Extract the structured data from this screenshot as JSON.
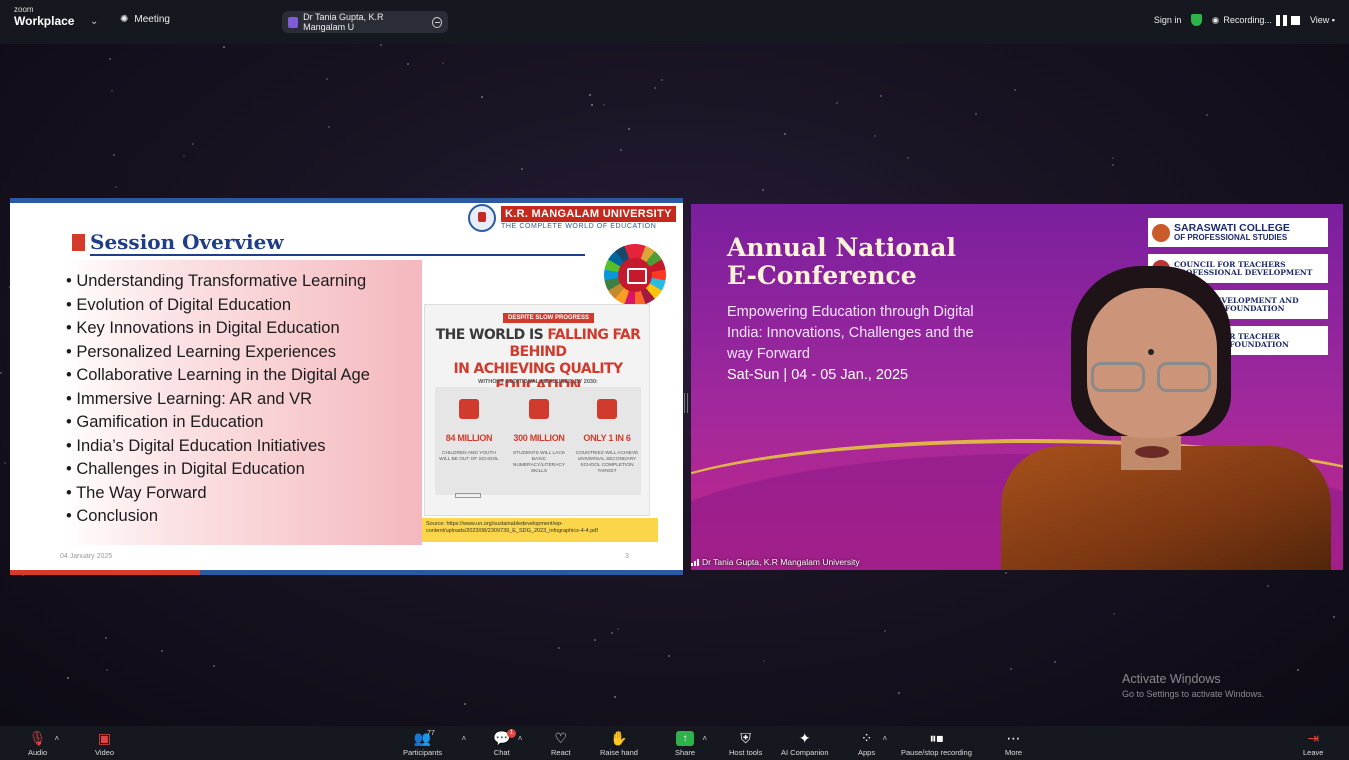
{
  "topbar": {
    "brand_small": "zoom",
    "brand": "Workplace",
    "meeting_label": "Meeting",
    "participant_pill": "Dr Tania Gupta, K.R Mangalam U",
    "sign_in": "Sign in",
    "recording": "Recording...",
    "view": "View"
  },
  "slide": {
    "title": "Session Overview",
    "university_name": "K.R. MANGALAM UNIVERSITY",
    "university_tagline": "THE COMPLETE WORLD OF EDUCATION",
    "bullets": [
      "Understanding Transformative Learning",
      "Evolution of Digital Education",
      "Key Innovations in Digital Education",
      "Personalized Learning Experiences",
      "Collaborative Learning in the Digital Age",
      "Immersive Learning: AR and VR",
      "Gamification in Education",
      "India’s Digital Education Initiatives",
      "Challenges in Digital Education",
      "The Way Forward",
      "Conclusion"
    ],
    "infographic": {
      "badge": "DESPITE SLOW PROGRESS",
      "headline_1": "THE WORLD IS",
      "headline_red": "FALLING FAR BEHIND",
      "headline_2": "IN ACHIEVING QUALITY EDUCATION",
      "subhead": "WITHOUT ADDITIONAL MEASURES, BY 2030:",
      "stats": [
        {
          "value": "84 MILLION",
          "desc": "CHILDREN AND YOUTH WILL BE OUT OF SCHOOL"
        },
        {
          "value": "300 MILLION",
          "desc": "STUDENTS WILL LACK BASIC NUMERACY/LITERACY SKILLS"
        },
        {
          "value": "ONLY 1 IN 6",
          "desc": "COUNTRIES WILL ACHIEVE UNIVERSAL SECONDARY SCHOOL COMPLETION TARGET"
        }
      ]
    },
    "source": "Source: https://www.un.org/sustainabledevelopment/wp-content/uploads/2023/08/2309739_E_SDG_2023_infographics-4-4.pdf",
    "date": "04 January 2025",
    "page": "3"
  },
  "speaker": {
    "title_line1": "Annual National",
    "title_line2": "E-Conference",
    "subtitle": "Empowering Education through Digital India: Innovations, Challenges and the way Forward",
    "dates": "Sat-Sun | 04 - 05 Jan., 2025",
    "logos": [
      {
        "line1": "SARASWATI COLLEGE",
        "line2": "OF PROFESSIONAL STUDIES"
      },
      {
        "line1": "COUNCIL FOR TEACHERS",
        "line2": "PROFESSIONAL DEVELOPMENT"
      },
      {
        "line1": "SOCIAL DEVELOPMENT AND",
        "line2": "RESEARCH FOUNDATION"
      },
      {
        "line1": "COUNCIL FOR TEACHER",
        "line2": "EDUCATION FOUNDATION"
      }
    ],
    "name": "Dr Tania Gupta, K.R Mangalam University"
  },
  "watermark": {
    "line1": "Activate Windows",
    "line2": "Go to Settings to activate Windows."
  },
  "toolbar": {
    "audio": "Audio",
    "video": "Video",
    "participants": "Participants",
    "participants_count": "77",
    "chat": "Chat",
    "chat_badge": "1",
    "react": "React",
    "raise_hand": "Raise hand",
    "share": "Share",
    "host_tools": "Host tools",
    "ai_companion": "AI Companion",
    "apps": "Apps",
    "pause_stop": "Pause/stop recording",
    "more": "More",
    "leave": "Leave"
  }
}
